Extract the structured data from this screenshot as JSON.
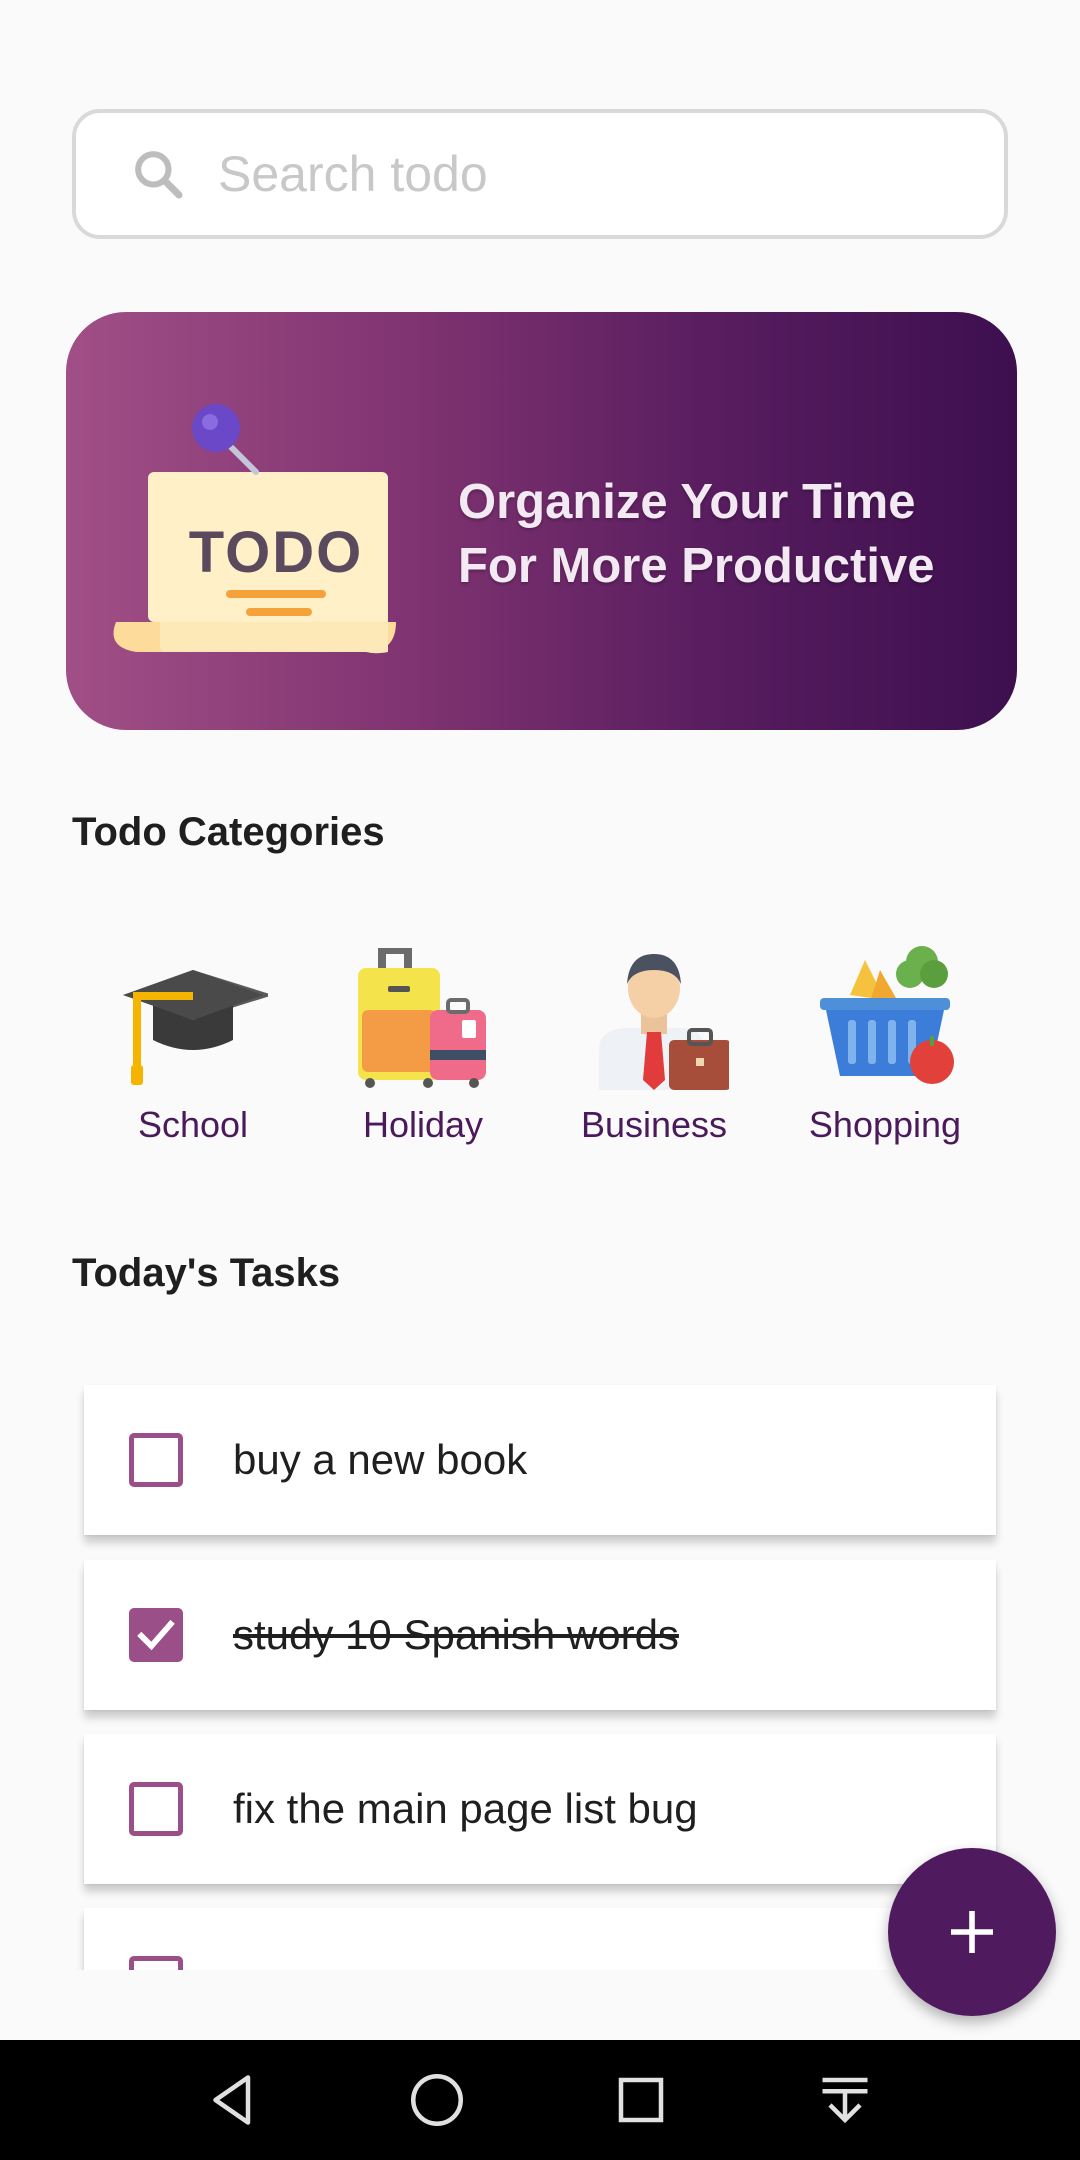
{
  "search": {
    "placeholder": "Search todo",
    "value": ""
  },
  "banner": {
    "line1": "Organize Your Time",
    "line2": "For More Productive",
    "illustration_text": "TODO"
  },
  "categories": {
    "title": "Todo Categories",
    "items": [
      {
        "label": "School",
        "icon": "graduation-cap-icon"
      },
      {
        "label": "Holiday",
        "icon": "luggage-icon"
      },
      {
        "label": "Business",
        "icon": "businessman-icon"
      },
      {
        "label": "Shopping",
        "icon": "shopping-basket-icon"
      }
    ]
  },
  "tasks": {
    "title": "Today's Tasks",
    "items": [
      {
        "text": "buy a new book",
        "done": false
      },
      {
        "text": "study 10 Spanish words",
        "done": true
      },
      {
        "text": "fix the main page list bug",
        "done": false
      },
      {
        "text": "",
        "done": false
      }
    ]
  },
  "fab": {
    "icon": "plus-icon"
  },
  "navbar": {
    "icons": [
      "back-icon",
      "home-icon",
      "recents-icon",
      "notifications-down-icon"
    ]
  },
  "colors": {
    "accent": "#4f1a5e",
    "checkbox": "#9b4f89",
    "category_label": "#4a1a5a",
    "banner_start": "#a14f86",
    "banner_end": "#3d0f4e"
  }
}
